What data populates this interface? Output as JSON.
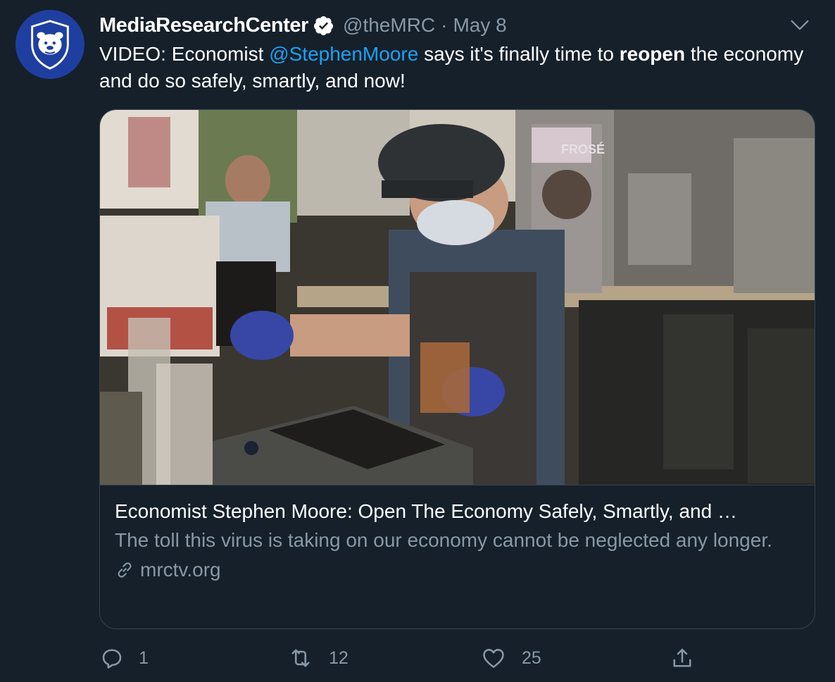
{
  "tweet": {
    "display_name": "MediaResearchCenter",
    "handle": "@theMRC",
    "separator": "·",
    "date": "May 8",
    "text": {
      "part1": "VIDEO: Economist ",
      "mention": "@StephenMoore",
      "part2": " says it's finally time to ",
      "bold": "reopen",
      "part3": " the economy and do so safely, smartly, and now!"
    }
  },
  "card": {
    "title": "Economist Stephen Moore: Open The Economy Safely, Smartly, and …",
    "description": "The toll this virus is taking on our economy cannot be neglected any longer.",
    "domain": "mrctv.org",
    "image_sign_text": "FROSÉ"
  },
  "actions": {
    "reply_count": "1",
    "retweet_count": "12",
    "like_count": "25"
  },
  "colors": {
    "background": "#15202b",
    "accent": "#1da1f2",
    "secondary_text": "#8899a6",
    "border": "#38444d",
    "avatar_bg": "#1f3fa0"
  },
  "icons": {
    "verified": "verified-badge-icon",
    "caret": "chevron-down-icon",
    "link": "link-icon",
    "reply": "reply-icon",
    "retweet": "retweet-icon",
    "like": "heart-icon",
    "share": "share-icon"
  }
}
